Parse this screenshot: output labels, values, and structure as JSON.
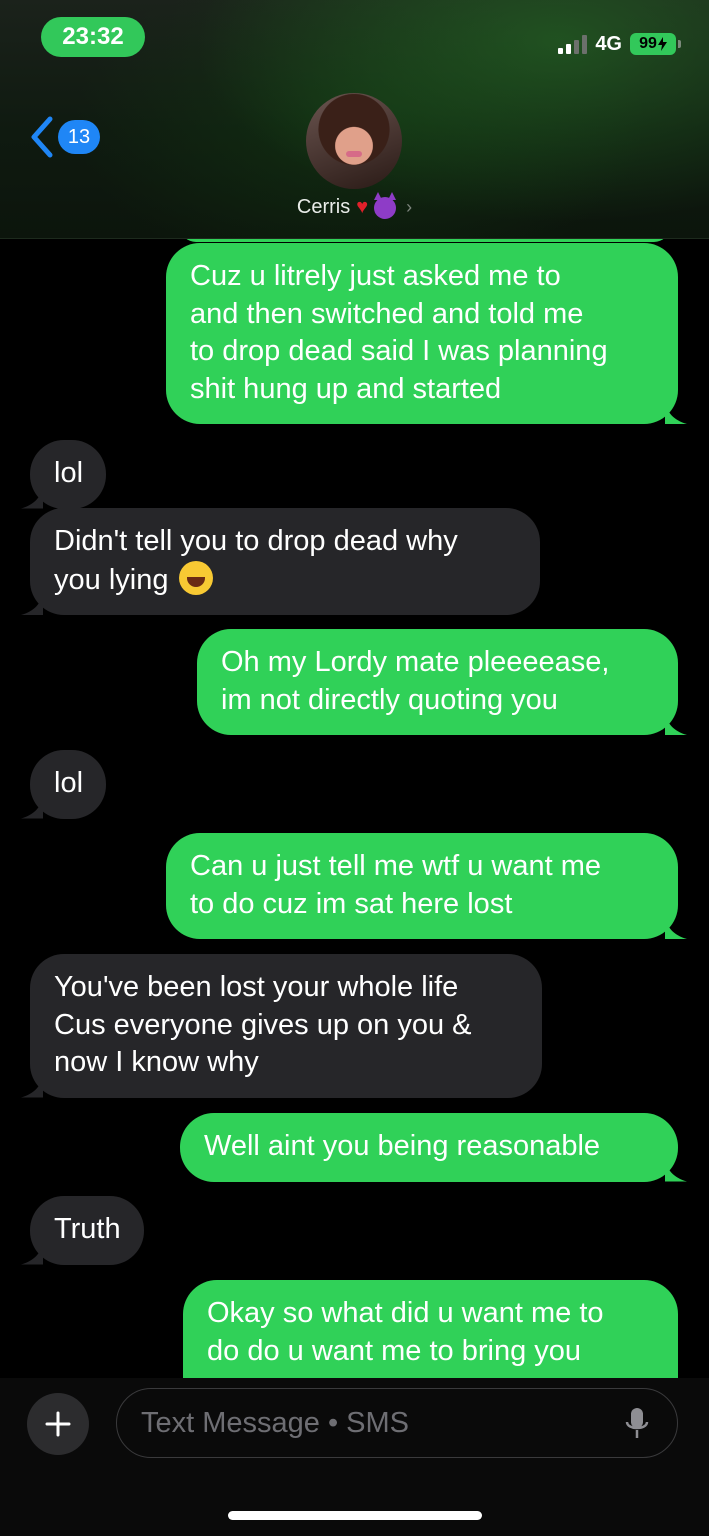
{
  "status_bar": {
    "time": "23:32",
    "network": "4G",
    "battery": "99"
  },
  "header": {
    "back_count": "13",
    "contact_name": "Cerris",
    "name_emojis": [
      "red-heart-icon",
      "smiling-devil-icon"
    ]
  },
  "messages": [
    {
      "direction": "out",
      "lines": [
        "Cuz u litrely just asked me to",
        "and then switched and told me",
        "to drop dead said I was planning",
        "shit hung up and started"
      ]
    },
    {
      "direction": "in",
      "lines": [
        "lol"
      ]
    },
    {
      "direction": "in",
      "lines": [
        "Didn't tell you to drop dead why",
        "you lying"
      ],
      "trailing_emoji": "tears-of-joy-icon"
    },
    {
      "direction": "out",
      "lines": [
        "Oh my Lordy mate pleeeease,",
        "im not directly quoting you"
      ]
    },
    {
      "direction": "in",
      "lines": [
        "lol"
      ]
    },
    {
      "direction": "out",
      "lines": [
        "Can u just tell me wtf u want me",
        "to do cuz im sat here lost"
      ]
    },
    {
      "direction": "in",
      "lines": [
        "You've been lost your whole life",
        "Cus everyone gives up on you &",
        "now I know why"
      ]
    },
    {
      "direction": "out",
      "lines": [
        "Well aint you being reasonable"
      ]
    },
    {
      "direction": "in",
      "lines": [
        "Truth"
      ]
    },
    {
      "direction": "out",
      "lines": [
        "Okay so what did u want me to",
        "do do u want me to bring you"
      ]
    }
  ],
  "composer": {
    "placeholder": "Text Message • SMS"
  },
  "colors": {
    "outgoing_bubble": "#30d158",
    "incoming_bubble": "#262629",
    "accent_blue": "#1f86f6"
  }
}
